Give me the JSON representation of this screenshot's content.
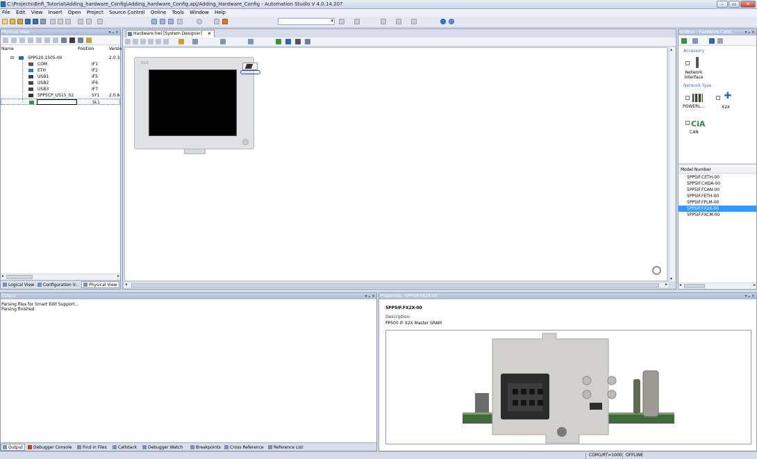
{
  "window": {
    "title": "C:\\Projects\\BnR_Tutorial\\Adding_hardware_Config\\Adding_hardware_Config.apj/Adding_Hardware_Config - Automation Studio V 4.0.14.207",
    "min": "–",
    "max": "▭",
    "close": "✕"
  },
  "menu": [
    "File",
    "Edit",
    "View",
    "Insert",
    "Open",
    "Project",
    "Source Control",
    "Online",
    "Tools",
    "Window",
    "Help"
  ],
  "physical_view": {
    "title": "Physical View",
    "pin_controls": "▾ ᵩ ✕",
    "columns": {
      "name": "Name",
      "position": "Position",
      "version": "Versio"
    },
    "rows": [
      {
        "name": "5PP520.1505-00",
        "position": "",
        "version": "2.0.3"
      },
      {
        "name": "COM",
        "position": "IF1",
        "version": ""
      },
      {
        "name": "ETH",
        "position": "IF2",
        "version": ""
      },
      {
        "name": "USB1",
        "position": "IF5",
        "version": ""
      },
      {
        "name": "USB2",
        "position": "IF6",
        "version": ""
      },
      {
        "name": "USB3",
        "position": "IF7",
        "version": ""
      },
      {
        "name": "5PP5CP_US15_02",
        "position": "SY1",
        "version": "2.0.6"
      },
      {
        "name": "",
        "position": "SL1",
        "version": ""
      }
    ],
    "tabs": [
      "Logical View",
      "Configuration V...",
      "Physical View"
    ]
  },
  "designer": {
    "tab_label": "Hardware.hwl [System Designer]",
    "tab_close": "×",
    "device_brand": "B&R"
  },
  "toolbox": {
    "title": "Toolbox - Hardware Catal...",
    "pin_controls": "▾ ᵩ ✕",
    "categories": {
      "accessory": "Accessory",
      "network_type": "Network Type"
    },
    "items": {
      "network_interface": "Network Interface",
      "powerlink": "POWERL...",
      "x2x": "X2X",
      "can": "CAN",
      "can_logo": "CiA"
    },
    "model_header": "Model Number",
    "models": [
      "5PP5IF.CETH-00",
      "5PP5IF.CHDA-00",
      "5PP5IF.FCAN-00",
      "5PP5IF.FETH-00",
      "5PP5IF.FPLM-00",
      "5PP5IF.FX2X-00",
      "5PP5IF.FXCM-00"
    ],
    "selected_model_index": 5
  },
  "output": {
    "title": "Output",
    "pin_controls": "▾ ᵩ ✕",
    "lines": [
      "Parsing files for Smart Edit Support...",
      "Parsing finished"
    ],
    "tabs": [
      "Output",
      "Debugger Console",
      "Find in Files",
      "Callstack",
      "Debugger Watch",
      "Breakpoints",
      "Cross Reference",
      "Reference List"
    ]
  },
  "properties": {
    "title": "Properties - 5PP5IF.FX2X-00",
    "pin_controls": "▾ ᵩ ✕",
    "model": "5PP5IF.FX2X-00",
    "description_label": "Description:",
    "description": "PP500 IF X2X Master SRAM"
  },
  "status": {
    "connection": "COM1/RT=1000",
    "state": "OFFLINE"
  },
  "colors": {
    "selection": "#3399ff",
    "category_text": "#3f72c5",
    "panel_header": "#a8b9d6"
  }
}
